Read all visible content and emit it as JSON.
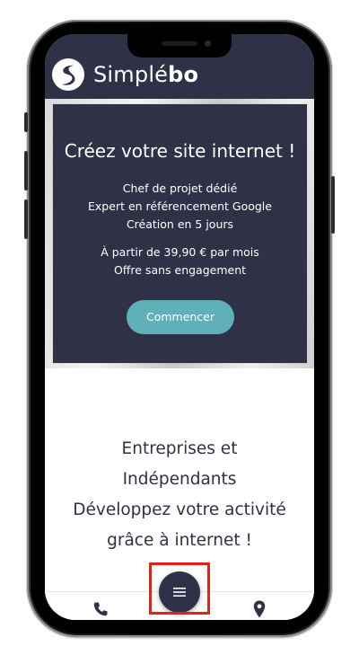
{
  "brand": {
    "name_light": "Simplé",
    "name_bold": "bo"
  },
  "hero": {
    "title": "Créez votre site internet !",
    "features": [
      "Chef de projet dédié",
      "Expert en référencement Google",
      "Création en 5 jours"
    ],
    "pricing": [
      "À partir de 39,90 € par mois",
      "Offre sans engagement"
    ],
    "cta_label": "Commencer"
  },
  "section": {
    "lines": [
      "Entreprises et",
      "Indépendants",
      "Développez votre activité",
      "grâce à internet !"
    ]
  },
  "bottom_nav": {
    "left_icon": "phone-icon",
    "center_icon": "menu-icon",
    "right_icon": "location-pin-icon"
  },
  "colors": {
    "navy": "#2f3146",
    "teal": "#5fb0b9",
    "highlight": "#e0241b"
  }
}
